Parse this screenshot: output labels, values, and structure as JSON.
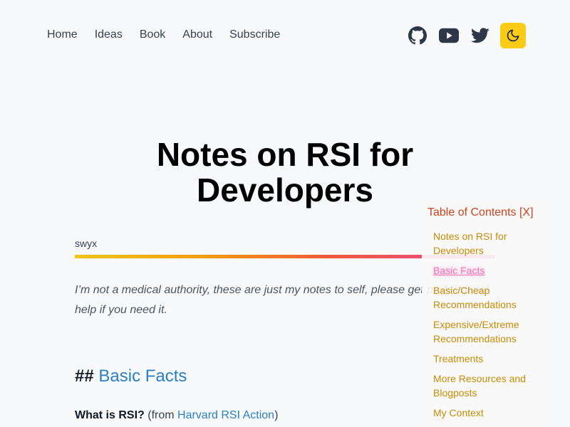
{
  "nav": {
    "links": [
      "Home",
      "Ideas",
      "Book",
      "About",
      "Subscribe"
    ],
    "icons": [
      "github-icon",
      "youtube-icon",
      "twitter-icon",
      "moon-icon"
    ],
    "toggle_color": "#facc15"
  },
  "article": {
    "title": "Notes on RSI for Developers",
    "author": "swyx",
    "intro": "I’m not a medical authority, these are just my notes to self, please get professional help if you need it.",
    "section": {
      "hash": "##",
      "heading": "Basic Facts"
    },
    "question": {
      "label": "What is RSI?",
      "from": "(from",
      "link": "Harvard RSI Action",
      "close": ")"
    }
  },
  "toc": {
    "title": "Table of Contents [X]",
    "items": [
      "Notes on RSI for Developers",
      "Basic Facts",
      "Basic/Cheap Recommendations",
      "Expensive/Extreme Recommendations",
      "Treatments",
      "More Resources and Blogposts",
      "My Context"
    ],
    "active_index": 1
  },
  "colors": {
    "link": "#2b7fc4",
    "toc_title": "#d0421b",
    "toc_item": "#ca8a04",
    "toc_active": "#f472b6"
  }
}
